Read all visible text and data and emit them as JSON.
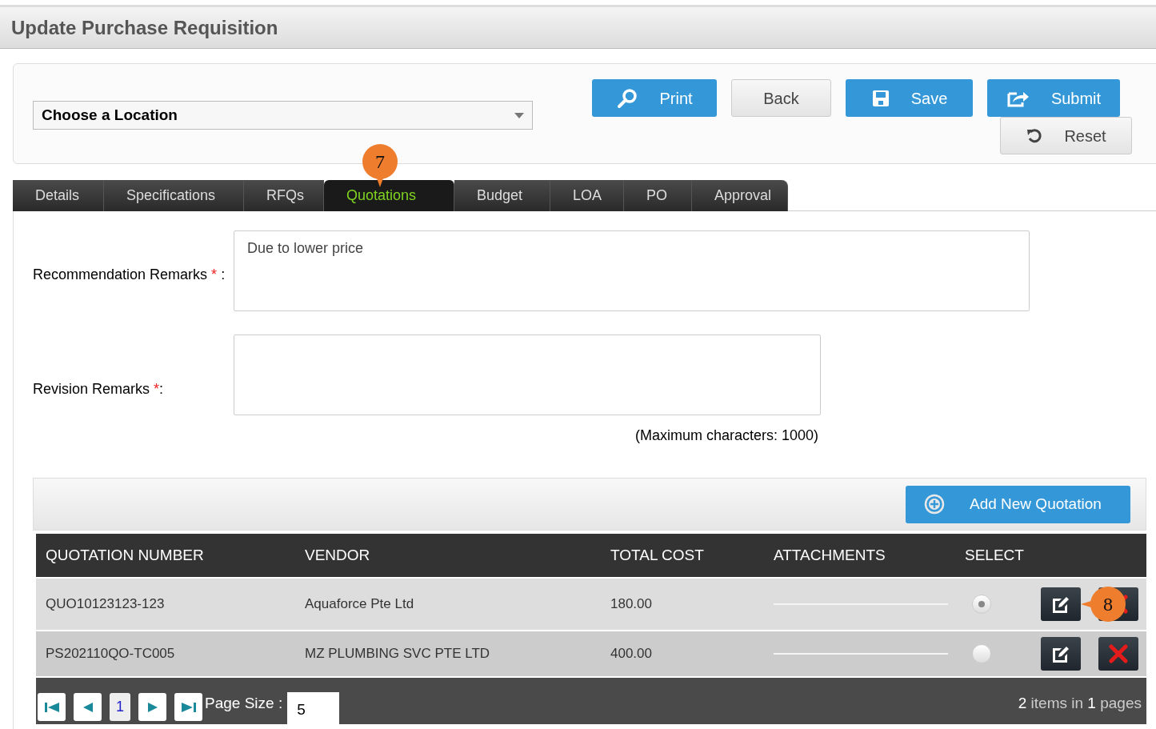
{
  "page_title": "Update Purchase Requisition",
  "location_select": {
    "value": "Choose a Location"
  },
  "buttons": [
    {
      "label": "Print",
      "kind": "print"
    },
    {
      "label": "Back",
      "kind": "back"
    },
    {
      "label": "Save",
      "kind": "save"
    },
    {
      "label": "Submit",
      "kind": "submit"
    },
    {
      "label": "Reset",
      "kind": "reset"
    }
  ],
  "tabs": [
    {
      "label": "Details",
      "selected": false
    },
    {
      "label": "Specifications",
      "selected": false
    },
    {
      "label": "RFQs",
      "selected": false
    },
    {
      "label": "Quotations",
      "selected": true,
      "callout": "7"
    },
    {
      "label": "Budget",
      "selected": false
    },
    {
      "label": "LOA",
      "selected": false
    },
    {
      "label": "PO",
      "selected": false
    },
    {
      "label": "Approval",
      "selected": false
    }
  ],
  "recommendation_remarks": {
    "label": "Recommendation Remarks",
    "required_mark": "*",
    "suffix": ":",
    "value": "Due to lower price"
  },
  "revision_remarks": {
    "label": "Revision Remarks",
    "required_mark": "*",
    "suffix": ":",
    "hint": "(Maximum characters: 1000)"
  },
  "add_button": "Add New Quotation",
  "table": {
    "columns": [
      "QUOTATION NUMBER",
      "VENDOR",
      "TOTAL COST",
      "ATTACHMENTS",
      "SELECT"
    ],
    "rows": [
      {
        "quotation_number": "QUO10123123-123",
        "vendor": "Aquaforce Pte Ltd",
        "total_cost": "180.00",
        "selected": true,
        "callout": "8"
      },
      {
        "quotation_number": "PS202110QO-TC005",
        "vendor": "MZ PLUMBING SVC PTE LTD",
        "total_cost": "400.00",
        "selected": false
      }
    ]
  },
  "pager": {
    "pages": [
      {
        "label": "1",
        "selected": true
      }
    ],
    "page_size_label": "Page Size :",
    "page_size": "5",
    "count": "2",
    "count_mid": "items in",
    "pages_count": "1",
    "count_end": "pages"
  }
}
